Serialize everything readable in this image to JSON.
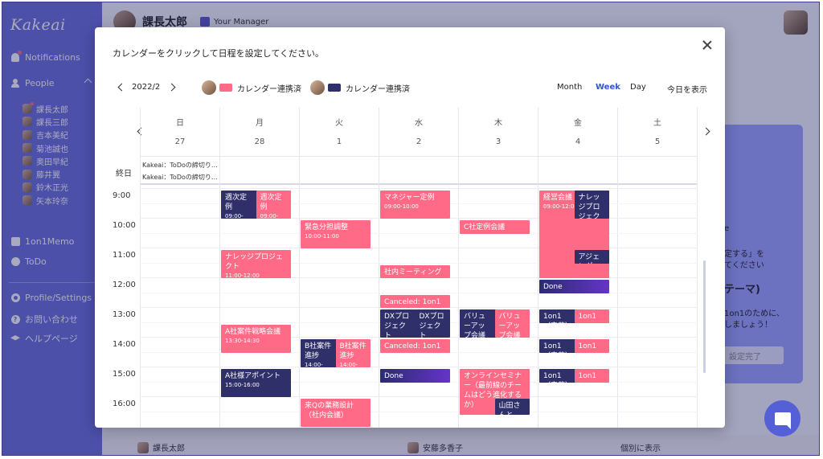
{
  "sidebar": {
    "logo": "Kakeai",
    "notifications": "Notifications",
    "people": "People",
    "people_list": [
      "課長太郎",
      "課長三郎",
      "吉本美紀",
      "菊池誠也",
      "奥田早紀",
      "藤井翼",
      "鈴木正光",
      "矢本玲奈"
    ],
    "memo": "1on1Memo",
    "todo": "ToDo",
    "profile": "Profile/Settings",
    "contact": "お問い合わせ",
    "help": "ヘルプページ"
  },
  "topbar": {
    "user_name": "課長太郎",
    "manager_label": "Your Manager"
  },
  "background": {
    "card_lines": [
      "e",
      "定する」を",
      "てください",
      "テーマ)",
      "1on1のために、",
      "しましょう！"
    ],
    "card_button": "設定完了",
    "bottom_user1": "課長太郎",
    "bottom_user2": "安藤多香子",
    "bottom_action": "個別に表示"
  },
  "modal": {
    "title": "カレンダーをクリックして日程を設定してください。",
    "month": "2022/2",
    "legend": [
      {
        "label": "カレンダー連携済",
        "color": "#ff6b86"
      },
      {
        "label": "カレンダー連携済",
        "color": "#2f2f6a"
      }
    ],
    "views": {
      "month": "Month",
      "week": "Week",
      "day": "Day",
      "today": "今日を表示"
    },
    "allday_label": "終日",
    "allday_events": [
      "Kakeai：ToDoの締切り…",
      "Kakeai：ToDoの締切り…"
    ]
  },
  "calendar": {
    "days": [
      {
        "name": "日",
        "num": "27"
      },
      {
        "name": "月",
        "num": "28"
      },
      {
        "name": "火",
        "num": "1"
      },
      {
        "name": "水",
        "num": "2"
      },
      {
        "name": "木",
        "num": "3"
      },
      {
        "name": "金",
        "num": "4"
      },
      {
        "name": "土",
        "num": "5"
      }
    ],
    "hours": [
      "9:00",
      "10:00",
      "11:00",
      "12:00",
      "13:00",
      "14:00",
      "15:00",
      "16:00"
    ],
    "events": [
      {
        "day": 1,
        "start": 9.0,
        "end": 10.0,
        "title": "週次定例",
        "time": "09:00-10:00",
        "color": "navy",
        "col": 0,
        "width": 0.45
      },
      {
        "day": 1,
        "start": 9.0,
        "end": 10.0,
        "title": "週次定例",
        "time": "09:00-",
        "color": "pink",
        "col": 0.43,
        "width": 0.43
      },
      {
        "day": 1,
        "start": 11.0,
        "end": 12.0,
        "title": "ナレッジプロジェクト",
        "time": "11:00-12:00",
        "color": "pink",
        "col": 0,
        "width": 0.86
      },
      {
        "day": 1,
        "start": 13.5,
        "end": 14.5,
        "title": "A社案件戦略会議",
        "time": "13:30-14:30",
        "color": "pink",
        "col": 0,
        "width": 0.86
      },
      {
        "day": 1,
        "start": 15.0,
        "end": 16.0,
        "title": "A社様アポイント",
        "time": "15:00-16:00",
        "color": "navy",
        "col": 0,
        "width": 0.86
      },
      {
        "day": 2,
        "start": 10.0,
        "end": 11.0,
        "title": "緊急分担調整",
        "time": "10:00-11:00",
        "color": "pink",
        "col": 0,
        "width": 0.86
      },
      {
        "day": 2,
        "start": 14.0,
        "end": 15.0,
        "title": "B社案件進捗",
        "time": "14:00-15:00",
        "color": "navy",
        "col": 0,
        "width": 0.45
      },
      {
        "day": 2,
        "start": 14.0,
        "end": 15.0,
        "title": "B社案件進捗",
        "time": "14:00-",
        "color": "pink",
        "col": 0.43,
        "width": 0.43
      },
      {
        "day": 2,
        "start": 16.0,
        "end": 17.0,
        "title": "来Qの業務設計（社内会議）",
        "time": "",
        "color": "pink",
        "col": 0,
        "width": 0.86
      },
      {
        "day": 3,
        "start": 9.0,
        "end": 10.0,
        "title": "マネジャー定例",
        "time": "09:00-10:00",
        "color": "pink",
        "col": 0,
        "width": 0.86
      },
      {
        "day": 3,
        "start": 11.5,
        "end": 12.0,
        "title": "社内ミーティング",
        "time": "",
        "color": "pink",
        "col": 0,
        "width": 0.86
      },
      {
        "day": 3,
        "start": 12.5,
        "end": 13.0,
        "title": "Canceled: 1on1",
        "time": "",
        "color": "pink",
        "col": 0,
        "width": 0.86
      },
      {
        "day": 3,
        "start": 13.0,
        "end": 14.0,
        "title": "DXプロジェクト",
        "time": "13:00-14:00",
        "color": "navy",
        "col": 0,
        "width": 0.45
      },
      {
        "day": 3,
        "start": 13.0,
        "end": 14.0,
        "title": "DXプロジェクト",
        "time": "",
        "color": "navy",
        "col": 0.43,
        "width": 0.43
      },
      {
        "day": 3,
        "start": 14.0,
        "end": 14.5,
        "title": "Canceled: 1on1",
        "time": "",
        "color": "pink",
        "col": 0,
        "width": 0.86
      },
      {
        "day": 3,
        "start": 15.0,
        "end": 15.5,
        "title": "Done",
        "time": "",
        "color": "done",
        "col": 0,
        "width": 0.86
      },
      {
        "day": 4,
        "start": 10.0,
        "end": 10.5,
        "title": "C社定例会議",
        "time": "",
        "color": "pink",
        "col": 0,
        "width": 0.86
      },
      {
        "day": 4,
        "start": 13.0,
        "end": 14.0,
        "title": "バリューアップ会議",
        "time": "13:00-14:00",
        "color": "navy",
        "col": 0,
        "width": 0.45
      },
      {
        "day": 4,
        "start": 13.0,
        "end": 14.0,
        "title": "バリューアップ会議",
        "time": "",
        "color": "pink",
        "col": 0.43,
        "width": 0.43
      },
      {
        "day": 4,
        "start": 15.0,
        "end": 16.6,
        "title": "オンラインセミナー（最前線のチームはどう進化するか）",
        "time": "",
        "color": "pink",
        "col": 0,
        "width": 0.86
      },
      {
        "day": 4,
        "start": 16.0,
        "end": 16.6,
        "title": "山田さんと",
        "time": "",
        "color": "navy",
        "col": 0.43,
        "width": 0.43
      },
      {
        "day": 5,
        "start": 9.0,
        "end": 12.0,
        "title": "経営会議",
        "time": "09:00-12:00",
        "color": "pink",
        "col": 0,
        "width": 0.86
      },
      {
        "day": 5,
        "start": 9.0,
        "end": 10.0,
        "title": "ナレッジプロジェクト",
        "time": "",
        "color": "navy",
        "col": 0.43,
        "width": 0.43
      },
      {
        "day": 5,
        "start": 11.0,
        "end": 11.5,
        "title": "アジェンダ",
        "time": "",
        "color": "navy",
        "col": 0.43,
        "width": 0.43
      },
      {
        "day": 5,
        "start": 12.0,
        "end": 12.5,
        "title": "Done",
        "time": "",
        "color": "done",
        "col": 0,
        "width": 0.86
      },
      {
        "day": 5,
        "start": 13.0,
        "end": 13.5,
        "title": "1on1（安藤）",
        "time": "",
        "color": "navy",
        "col": 0,
        "width": 0.45
      },
      {
        "day": 5,
        "start": 13.0,
        "end": 13.5,
        "title": "1on1",
        "time": "",
        "color": "pink",
        "col": 0.43,
        "width": 0.43
      },
      {
        "day": 5,
        "start": 14.0,
        "end": 14.5,
        "title": "1on1（安藤）",
        "time": "",
        "color": "navy",
        "col": 0,
        "width": 0.45
      },
      {
        "day": 5,
        "start": 14.0,
        "end": 14.5,
        "title": "1on1",
        "time": "",
        "color": "pink",
        "col": 0.43,
        "width": 0.43
      },
      {
        "day": 5,
        "start": 15.0,
        "end": 15.5,
        "title": "1on1（安藤）",
        "time": "",
        "color": "navy",
        "col": 0,
        "width": 0.45
      },
      {
        "day": 5,
        "start": 15.0,
        "end": 15.5,
        "title": "1on1",
        "time": "",
        "color": "pink",
        "col": 0.43,
        "width": 0.43
      }
    ]
  },
  "colors": {
    "sidebar": "#6a6fd9",
    "accent_pink": "#ff6b86",
    "accent_navy": "#2f2f6a",
    "active_view": "#2f55d4"
  }
}
